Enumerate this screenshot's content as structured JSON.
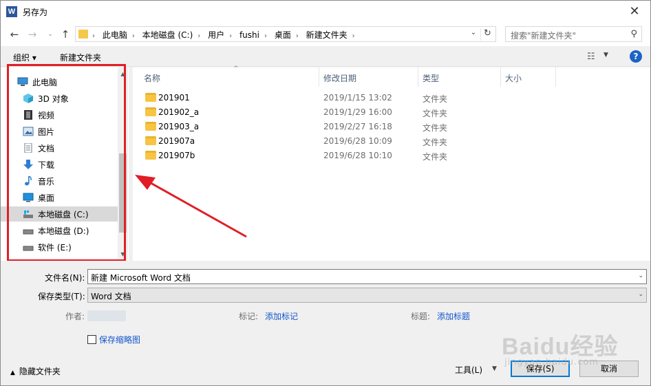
{
  "window": {
    "title": "另存为",
    "app_icon_letter": "W"
  },
  "address": {
    "crumbs": [
      "此电脑",
      "本地磁盘 (C:)",
      "用户",
      "fushi",
      "桌面",
      "新建文件夹"
    ],
    "search_placeholder": "搜索\"新建文件夹\""
  },
  "toolbar": {
    "organize": "组织 ▾",
    "new_folder": "新建文件夹"
  },
  "nav": {
    "items": [
      {
        "label": "此电脑",
        "icon": "computer-icon"
      },
      {
        "label": "3D 对象",
        "icon": "cube-icon"
      },
      {
        "label": "视频",
        "icon": "film-icon"
      },
      {
        "label": "图片",
        "icon": "picture-icon"
      },
      {
        "label": "文档",
        "icon": "document-icon"
      },
      {
        "label": "下载",
        "icon": "download-icon"
      },
      {
        "label": "音乐",
        "icon": "music-icon"
      },
      {
        "label": "桌面",
        "icon": "desktop-icon"
      },
      {
        "label": "本地磁盘 (C:)",
        "icon": "system-drive-icon",
        "selected": true
      },
      {
        "label": "本地磁盘 (D:)",
        "icon": "drive-icon"
      },
      {
        "label": "软件 (E:)",
        "icon": "drive-icon"
      }
    ]
  },
  "columns": {
    "name": "名称",
    "date": "修改日期",
    "type": "类型",
    "size": "大小"
  },
  "files": [
    {
      "name": "201901",
      "date": "2019/1/15 13:02",
      "type": "文件夹"
    },
    {
      "name": "201902_a",
      "date": "2019/1/29 16:00",
      "type": "文件夹"
    },
    {
      "name": "201903_a",
      "date": "2019/2/27 16:18",
      "type": "文件夹"
    },
    {
      "name": "201907a",
      "date": "2019/6/28 10:09",
      "type": "文件夹"
    },
    {
      "name": "201907b",
      "date": "2019/6/28 10:10",
      "type": "文件夹"
    }
  ],
  "form": {
    "filename_label": "文件名(N):",
    "filename_value": "新建 Microsoft Word 文档",
    "filetype_label": "保存类型(T):",
    "filetype_value": "Word 文档",
    "author_label": "作者:",
    "tags_label": "标记:",
    "tags_link": "添加标记",
    "title_label": "标题:",
    "title_link": "添加标题",
    "thumbnail_label": "保存缩略图",
    "hide_folders": "隐藏文件夹",
    "tools": "工具(L)",
    "save": "保存(S)",
    "cancel": "取消"
  },
  "watermark": {
    "brand": "Baidu经验",
    "url": "jingyan.baidu.com"
  },
  "colors": {
    "highlight": "#e01e26",
    "link": "#1155cc",
    "accent": "#0078d7"
  }
}
